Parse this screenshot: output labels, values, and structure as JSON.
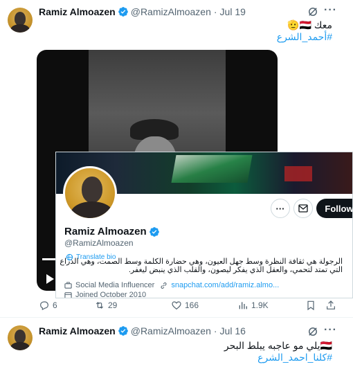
{
  "tweet1": {
    "name": "Ramiz Almoazen",
    "handle": "@RamizAlmoazen",
    "separator": "·",
    "date": "Jul 19",
    "text_line1": "معك 🇾🇪🫡",
    "hashtag": "#أحمد_الشرع",
    "card": {
      "name": "Ramiz Almoazen",
      "handle": "@RamizAlmoazen",
      "follow_label": "Follow",
      "translate_label": "Translate bio",
      "bio": "الرجولة هي ثقافة النظرة وسط جهل العيون، وهي حضارة الكلمة وسط الصمت، وهي الذراع التي تمتد لتحمي، والعقل الذي يفكر ليصون، والقلب الذي ينبض ليغفر.",
      "category": "Social Media Influencer",
      "link": "snapchat.com/add/ramiz.almo...",
      "joined": "Joined October 2010"
    },
    "actions": {
      "replies": "6",
      "reposts": "29",
      "likes": "166",
      "views": "1.9K"
    }
  },
  "tweet2": {
    "name": "Ramiz Almoazen",
    "handle": "@RamizAlmoazen",
    "separator": "·",
    "date": "Jul 16",
    "text_line1": "🇾🇪يلي مو عاجبه يبلط البحر",
    "hashtag": "#كلنا_احمد_الشرع"
  },
  "colors": {
    "accent": "#1d9bf0",
    "text": "#0f1419",
    "secondary": "#536471"
  },
  "icons": [
    "verified-icon",
    "grok-icon",
    "more-icon",
    "reply-icon",
    "repost-icon",
    "like-icon",
    "views-icon",
    "bookmark-icon",
    "share-icon",
    "play-icon",
    "mail-icon",
    "translate-icon",
    "briefcase-icon",
    "calendar-icon"
  ]
}
